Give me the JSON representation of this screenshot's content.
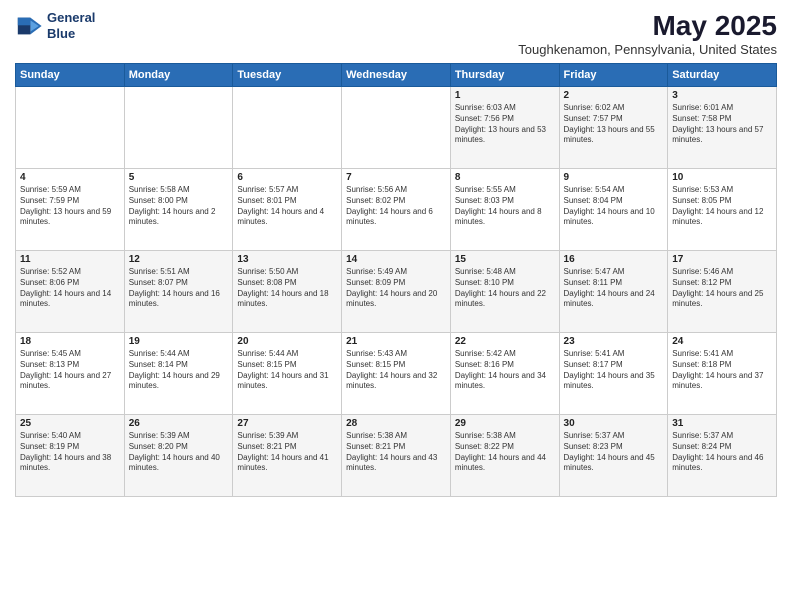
{
  "logo": {
    "line1": "General",
    "line2": "Blue"
  },
  "title": "May 2025",
  "subtitle": "Toughkenamon, Pennsylvania, United States",
  "headers": [
    "Sunday",
    "Monday",
    "Tuesday",
    "Wednesday",
    "Thursday",
    "Friday",
    "Saturday"
  ],
  "weeks": [
    [
      {
        "day": "",
        "sunrise": "",
        "sunset": "",
        "daylight": ""
      },
      {
        "day": "",
        "sunrise": "",
        "sunset": "",
        "daylight": ""
      },
      {
        "day": "",
        "sunrise": "",
        "sunset": "",
        "daylight": ""
      },
      {
        "day": "",
        "sunrise": "",
        "sunset": "",
        "daylight": ""
      },
      {
        "day": "1",
        "sunrise": "Sunrise: 6:03 AM",
        "sunset": "Sunset: 7:56 PM",
        "daylight": "Daylight: 13 hours and 53 minutes."
      },
      {
        "day": "2",
        "sunrise": "Sunrise: 6:02 AM",
        "sunset": "Sunset: 7:57 PM",
        "daylight": "Daylight: 13 hours and 55 minutes."
      },
      {
        "day": "3",
        "sunrise": "Sunrise: 6:01 AM",
        "sunset": "Sunset: 7:58 PM",
        "daylight": "Daylight: 13 hours and 57 minutes."
      }
    ],
    [
      {
        "day": "4",
        "sunrise": "Sunrise: 5:59 AM",
        "sunset": "Sunset: 7:59 PM",
        "daylight": "Daylight: 13 hours and 59 minutes."
      },
      {
        "day": "5",
        "sunrise": "Sunrise: 5:58 AM",
        "sunset": "Sunset: 8:00 PM",
        "daylight": "Daylight: 14 hours and 2 minutes."
      },
      {
        "day": "6",
        "sunrise": "Sunrise: 5:57 AM",
        "sunset": "Sunset: 8:01 PM",
        "daylight": "Daylight: 14 hours and 4 minutes."
      },
      {
        "day": "7",
        "sunrise": "Sunrise: 5:56 AM",
        "sunset": "Sunset: 8:02 PM",
        "daylight": "Daylight: 14 hours and 6 minutes."
      },
      {
        "day": "8",
        "sunrise": "Sunrise: 5:55 AM",
        "sunset": "Sunset: 8:03 PM",
        "daylight": "Daylight: 14 hours and 8 minutes."
      },
      {
        "day": "9",
        "sunrise": "Sunrise: 5:54 AM",
        "sunset": "Sunset: 8:04 PM",
        "daylight": "Daylight: 14 hours and 10 minutes."
      },
      {
        "day": "10",
        "sunrise": "Sunrise: 5:53 AM",
        "sunset": "Sunset: 8:05 PM",
        "daylight": "Daylight: 14 hours and 12 minutes."
      }
    ],
    [
      {
        "day": "11",
        "sunrise": "Sunrise: 5:52 AM",
        "sunset": "Sunset: 8:06 PM",
        "daylight": "Daylight: 14 hours and 14 minutes."
      },
      {
        "day": "12",
        "sunrise": "Sunrise: 5:51 AM",
        "sunset": "Sunset: 8:07 PM",
        "daylight": "Daylight: 14 hours and 16 minutes."
      },
      {
        "day": "13",
        "sunrise": "Sunrise: 5:50 AM",
        "sunset": "Sunset: 8:08 PM",
        "daylight": "Daylight: 14 hours and 18 minutes."
      },
      {
        "day": "14",
        "sunrise": "Sunrise: 5:49 AM",
        "sunset": "Sunset: 8:09 PM",
        "daylight": "Daylight: 14 hours and 20 minutes."
      },
      {
        "day": "15",
        "sunrise": "Sunrise: 5:48 AM",
        "sunset": "Sunset: 8:10 PM",
        "daylight": "Daylight: 14 hours and 22 minutes."
      },
      {
        "day": "16",
        "sunrise": "Sunrise: 5:47 AM",
        "sunset": "Sunset: 8:11 PM",
        "daylight": "Daylight: 14 hours and 24 minutes."
      },
      {
        "day": "17",
        "sunrise": "Sunrise: 5:46 AM",
        "sunset": "Sunset: 8:12 PM",
        "daylight": "Daylight: 14 hours and 25 minutes."
      }
    ],
    [
      {
        "day": "18",
        "sunrise": "Sunrise: 5:45 AM",
        "sunset": "Sunset: 8:13 PM",
        "daylight": "Daylight: 14 hours and 27 minutes."
      },
      {
        "day": "19",
        "sunrise": "Sunrise: 5:44 AM",
        "sunset": "Sunset: 8:14 PM",
        "daylight": "Daylight: 14 hours and 29 minutes."
      },
      {
        "day": "20",
        "sunrise": "Sunrise: 5:44 AM",
        "sunset": "Sunset: 8:15 PM",
        "daylight": "Daylight: 14 hours and 31 minutes."
      },
      {
        "day": "21",
        "sunrise": "Sunrise: 5:43 AM",
        "sunset": "Sunset: 8:15 PM",
        "daylight": "Daylight: 14 hours and 32 minutes."
      },
      {
        "day": "22",
        "sunrise": "Sunrise: 5:42 AM",
        "sunset": "Sunset: 8:16 PM",
        "daylight": "Daylight: 14 hours and 34 minutes."
      },
      {
        "day": "23",
        "sunrise": "Sunrise: 5:41 AM",
        "sunset": "Sunset: 8:17 PM",
        "daylight": "Daylight: 14 hours and 35 minutes."
      },
      {
        "day": "24",
        "sunrise": "Sunrise: 5:41 AM",
        "sunset": "Sunset: 8:18 PM",
        "daylight": "Daylight: 14 hours and 37 minutes."
      }
    ],
    [
      {
        "day": "25",
        "sunrise": "Sunrise: 5:40 AM",
        "sunset": "Sunset: 8:19 PM",
        "daylight": "Daylight: 14 hours and 38 minutes."
      },
      {
        "day": "26",
        "sunrise": "Sunrise: 5:39 AM",
        "sunset": "Sunset: 8:20 PM",
        "daylight": "Daylight: 14 hours and 40 minutes."
      },
      {
        "day": "27",
        "sunrise": "Sunrise: 5:39 AM",
        "sunset": "Sunset: 8:21 PM",
        "daylight": "Daylight: 14 hours and 41 minutes."
      },
      {
        "day": "28",
        "sunrise": "Sunrise: 5:38 AM",
        "sunset": "Sunset: 8:21 PM",
        "daylight": "Daylight: 14 hours and 43 minutes."
      },
      {
        "day": "29",
        "sunrise": "Sunrise: 5:38 AM",
        "sunset": "Sunset: 8:22 PM",
        "daylight": "Daylight: 14 hours and 44 minutes."
      },
      {
        "day": "30",
        "sunrise": "Sunrise: 5:37 AM",
        "sunset": "Sunset: 8:23 PM",
        "daylight": "Daylight: 14 hours and 45 minutes."
      },
      {
        "day": "31",
        "sunrise": "Sunrise: 5:37 AM",
        "sunset": "Sunset: 8:24 PM",
        "daylight": "Daylight: 14 hours and 46 minutes."
      }
    ]
  ]
}
